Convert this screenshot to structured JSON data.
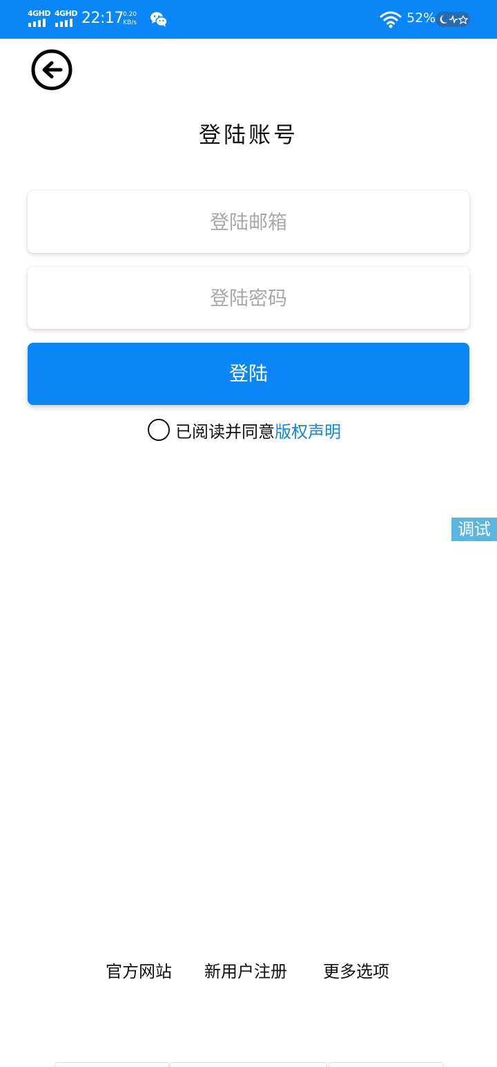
{
  "status_bar": {
    "signal_1": "4GHD",
    "signal_2": "4GHD",
    "time": "22:17",
    "net_speed_value": "0.20",
    "net_speed_unit": "KB/s",
    "battery": "52%",
    "icons": [
      "signal-icon",
      "wechat-icon",
      "wifi-icon",
      "moon-icon"
    ]
  },
  "header": {
    "back_icon": "back-arrow-circle-icon",
    "title": "登陆账号"
  },
  "form": {
    "email_placeholder": "登陆邮箱",
    "email_value": "",
    "password_placeholder": "登陆密码",
    "password_value": "",
    "submit_label": "登陆"
  },
  "agreement": {
    "checked": false,
    "text": "已阅读并同意",
    "link_text": "版权声明"
  },
  "debug": {
    "label": "调试"
  },
  "footer": {
    "links": [
      {
        "label": "官方网站"
      },
      {
        "label": "新用户注册"
      },
      {
        "label": "更多选项"
      }
    ]
  },
  "colors": {
    "primary": "#0a86f6",
    "debug": "#5bb5de",
    "text": "#111111",
    "placeholder": "#a8a8a8"
  }
}
